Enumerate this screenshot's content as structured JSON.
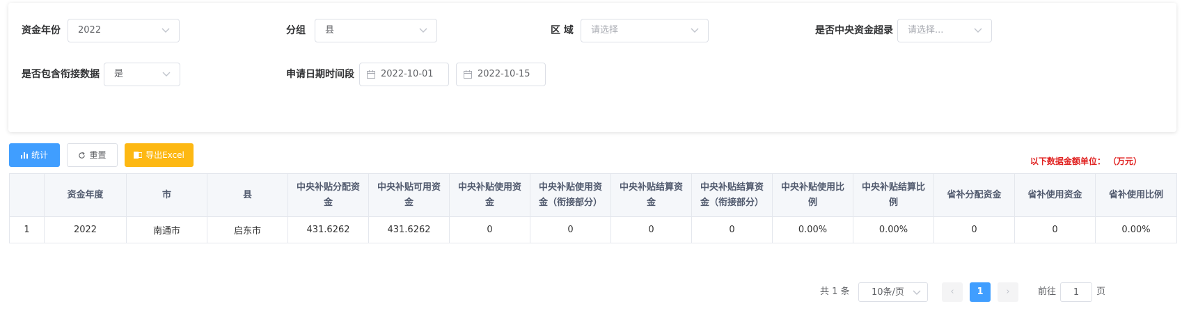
{
  "filters": {
    "fund_year": {
      "label": "资金年份",
      "value": "2022"
    },
    "group": {
      "label": "分组",
      "value": "县"
    },
    "region": {
      "label": "区 域",
      "placeholder": "请选择"
    },
    "central_over": {
      "label": "是否中央资金超录",
      "placeholder": "请选择..."
    },
    "include_link": {
      "label": "是否包含衔接数据",
      "value": "是"
    },
    "apply_date": {
      "label": "申请日期时间段",
      "start": "2022-10-01",
      "end": "2022-10-15"
    }
  },
  "toolbar": {
    "stats_label": "统计",
    "reset_label": "重置",
    "export_label": "导出Excel",
    "unit_note": "以下数据金额单位： （万元）"
  },
  "table": {
    "headers": [
      "",
      "资金年度",
      "市",
      "县",
      "中央补贴分配资金",
      "中央补贴可用资金",
      "中央补贴使用资金",
      "中央补贴使用资金（衔接部分）",
      "中央补贴结算资金",
      "中央补贴结算资金（衔接部分）",
      "中央补贴使用比例",
      "中央补贴结算比例",
      "省补分配资金",
      "省补使用资金",
      "省补使用比例"
    ],
    "rows": [
      [
        "1",
        "2022",
        "南通市",
        "启东市",
        "431.6262",
        "431.6262",
        "0",
        "0",
        "0",
        "0",
        "0.00%",
        "0.00%",
        "0",
        "0",
        "0.00%"
      ]
    ]
  },
  "pagination": {
    "total": "共 1 条",
    "page_size": "10条/页",
    "prev": "‹",
    "current": "1",
    "next": "›",
    "goto_label": "前往",
    "goto_value": "1",
    "page_suffix": "页"
  },
  "colors": {
    "accent": "#409eff",
    "export": "#fdb813",
    "note": "#e0201f"
  }
}
